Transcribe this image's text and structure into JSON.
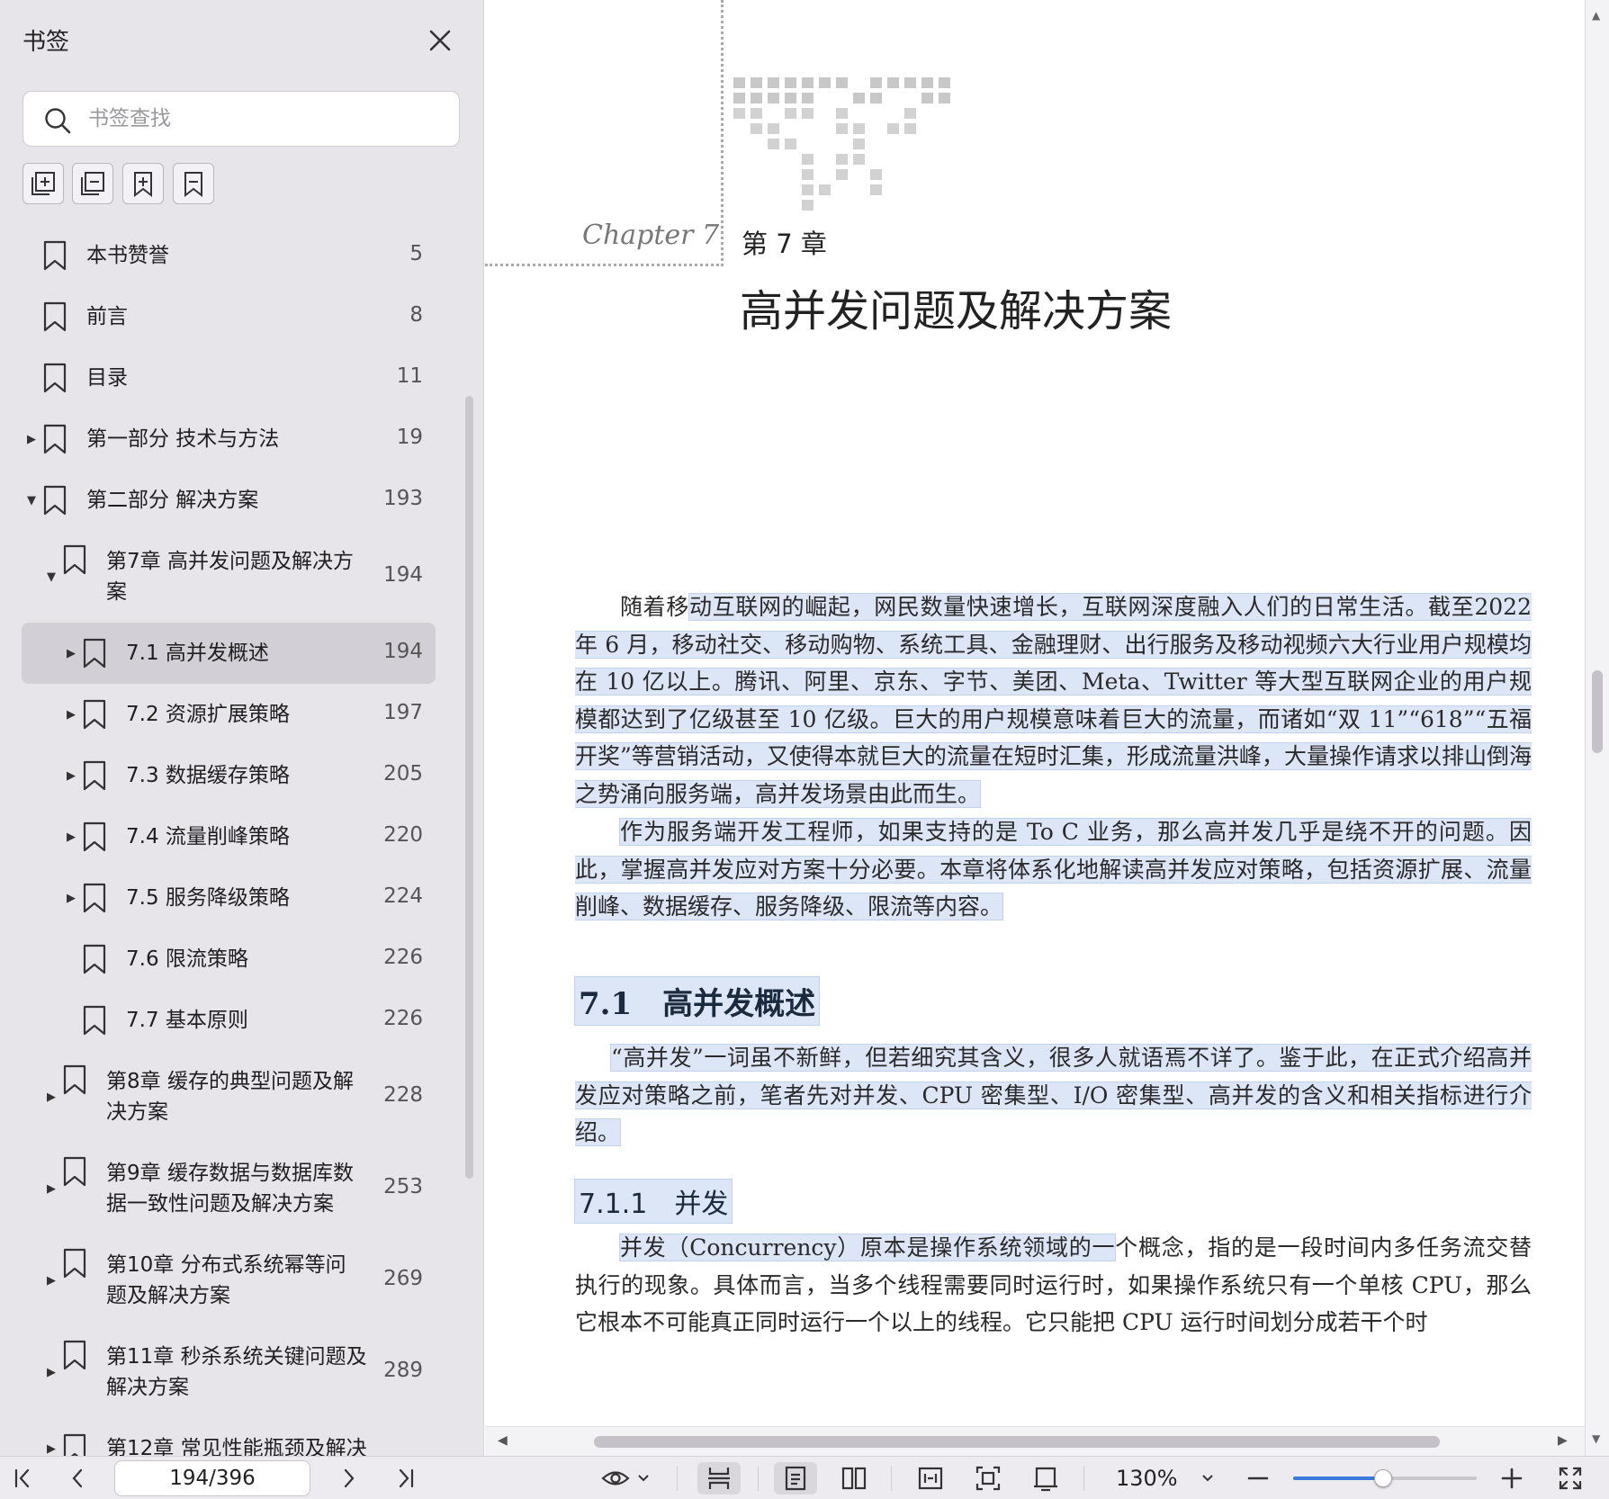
{
  "sidebar": {
    "title": "书签",
    "search": {
      "placeholder": "书签查找",
      "value": ""
    },
    "toolbar": [
      "expand-all-icon",
      "collapse-all-icon",
      "add-bookmark-icon",
      "remove-bookmark-icon"
    ],
    "items": [
      {
        "label": [
          "本书赞誉"
        ],
        "page": "5",
        "level": 0,
        "arrow": "none"
      },
      {
        "label": [
          "前言"
        ],
        "page": "8",
        "level": 0,
        "arrow": "none"
      },
      {
        "label": [
          "目录"
        ],
        "page": "11",
        "level": 0,
        "arrow": "none"
      },
      {
        "label": [
          "第一部分 技术与方法"
        ],
        "page": "19",
        "level": 0,
        "arrow": "collapsed"
      },
      {
        "label": [
          "第二部分 解决方案"
        ],
        "page": "193",
        "level": 0,
        "arrow": "expanded"
      },
      {
        "label": [
          "第7章 高并发问题及解决方",
          "案"
        ],
        "page": "194",
        "level": 1,
        "arrow": "expanded"
      },
      {
        "label": [
          "7.1 高并发概述"
        ],
        "page": "194",
        "level": 2,
        "arrow": "collapsed",
        "selected": true
      },
      {
        "label": [
          "7.2 资源扩展策略"
        ],
        "page": "197",
        "level": 2,
        "arrow": "collapsed"
      },
      {
        "label": [
          "7.3 数据缓存策略"
        ],
        "page": "205",
        "level": 2,
        "arrow": "collapsed"
      },
      {
        "label": [
          "7.4 流量削峰策略"
        ],
        "page": "220",
        "level": 2,
        "arrow": "collapsed"
      },
      {
        "label": [
          "7.5 服务降级策略"
        ],
        "page": "224",
        "level": 2,
        "arrow": "collapsed"
      },
      {
        "label": [
          "7.6 限流策略"
        ],
        "page": "226",
        "level": 2,
        "arrow": "none"
      },
      {
        "label": [
          "7.7 基本原则"
        ],
        "page": "226",
        "level": 2,
        "arrow": "none"
      },
      {
        "label": [
          "第8章 缓存的典型问题及解",
          "决方案"
        ],
        "page": "228",
        "level": 1,
        "arrow": "collapsed"
      },
      {
        "label": [
          "第9章 缓存数据与数据库数",
          "据一致性问题及解决方案"
        ],
        "page": "253",
        "level": 1,
        "arrow": "collapsed"
      },
      {
        "label": [
          "第10章 分布式系统幂等问",
          "题及解决方案"
        ],
        "page": "269",
        "level": 1,
        "arrow": "collapsed"
      },
      {
        "label": [
          "第11章 秒杀系统关键问题及",
          "解决方案"
        ],
        "page": "289",
        "level": 1,
        "arrow": "collapsed"
      },
      {
        "label": [
          "第12章 常见性能瓶颈及解决"
        ],
        "page": "",
        "level": 1,
        "arrow": "collapsed"
      }
    ]
  },
  "document": {
    "chapter_script": "Chapter 7",
    "chapter_number": "第 7 章",
    "chapter_title": "高并发问题及解决方案",
    "paragraphs": [
      {
        "pre": "随着移",
        "hl": "动互联网的崛起，网民数量快速增长，互联网深度融入人们的日常生活。截至2022 年 6 月，移动社交、移动购物、系统工具、金融理财、出行服务及移动视频六大行业用户规模均在 10 亿以上。腾讯、阿里、京东、字节、美团、Meta、Twitter 等大型互联网企业的用户规模都达到了亿级甚至 10 亿级。巨大的用户规模意味着巨大的流量，而诸如“双 11”“618”“五福开奖”等营销活动，又使得本就巨大的流量在短时汇集，形成流量洪峰，大量操作请求以排山倒海之势涌向服务端，高并发场景由此而生。",
        "post": ""
      },
      {
        "pre": "",
        "hl": "作为服务端开发工程师，如果支持的是 To C 业务，那么高并发几乎是绕不开的问题。因此，掌握高并发应对方案十分必要。本章将体系化地解读高并发应对策略，包括资源扩展、流量削峰、数据缓存、服务降级、限流等内容。",
        "post": ""
      },
      {
        "pre": "",
        "hl": "“高并发”一词虽不新鲜，但若细究其含义，很多人就语焉不详了。鉴于此，在正式介绍高并发应对策略之前，笔者先对并发、CPU 密集型、I/O 密集型、高并发的含义和相关指标进行介绍。",
        "post": ""
      },
      {
        "pre": "",
        "hl": "并发（Concurrency）原本是操作系统领域的一",
        "post": "个概念，指的是一段时间内多任务流交替执行的现象。具体而言，当多个线程需要同时运行时，如果操作系统只有一个单核 CPU，那么它根本不可能真正同时运行一个以上的线程。它只能把 CPU 运行时间划分成若干个时"
      }
    ],
    "section_title": "7.1　高并发概述",
    "subsection_title": "7.1.1　并发"
  },
  "bottombar": {
    "page_indicator": "194/396",
    "zoom": "130%",
    "zoom_level": 0.49,
    "icons": [
      "first-page-icon",
      "prev-page-icon",
      "next-page-icon",
      "last-page-icon",
      "eye-icon",
      "dropdown-icon",
      "continuous-scroll-icon",
      "single-page-icon",
      "two-page-icon",
      "fit-width-icon",
      "fit-page-icon",
      "actual-size-icon",
      "zoom-dropdown-icon",
      "zoom-out-icon",
      "zoom-in-icon",
      "fullscreen-icon"
    ]
  }
}
